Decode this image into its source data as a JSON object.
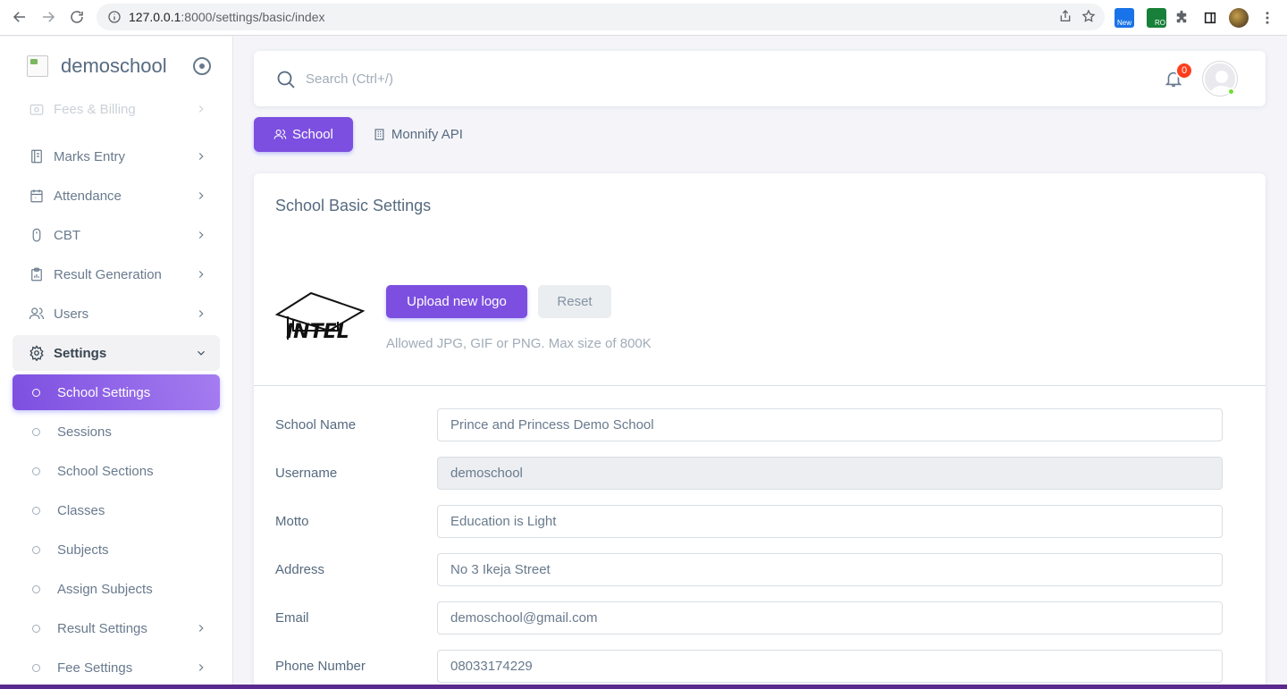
{
  "browser": {
    "url_host": "127.0.0.1",
    "url_path": ":8000/settings/basic/index"
  },
  "sidebar": {
    "brand": "demoschool",
    "items": [
      {
        "label": "Fees & Billing"
      },
      {
        "label": "Marks Entry"
      },
      {
        "label": "Attendance"
      },
      {
        "label": "CBT"
      },
      {
        "label": "Result Generation"
      },
      {
        "label": "Users"
      },
      {
        "label": "Settings"
      }
    ],
    "subitems": [
      {
        "label": "School Settings"
      },
      {
        "label": "Sessions"
      },
      {
        "label": "School Sections"
      },
      {
        "label": "Classes"
      },
      {
        "label": "Subjects"
      },
      {
        "label": "Assign Subjects"
      },
      {
        "label": "Result Settings"
      },
      {
        "label": "Fee Settings"
      }
    ]
  },
  "topbar": {
    "search_placeholder": "Search (Ctrl+/)",
    "notification_count": "0"
  },
  "tabs": [
    {
      "label": "School"
    },
    {
      "label": "Monnify API"
    }
  ],
  "card": {
    "title": "School Basic Settings",
    "logo_text": "INTEL",
    "upload_label": "Upload new logo",
    "reset_label": "Reset",
    "upload_hint": "Allowed JPG, GIF or PNG. Max size of 800K"
  },
  "form": {
    "school_name": {
      "label": "School Name",
      "value": "Prince and Princess Demo School"
    },
    "username": {
      "label": "Username",
      "value": "demoschool"
    },
    "motto": {
      "label": "Motto",
      "value": "Education is Light"
    },
    "address": {
      "label": "Address",
      "value": "No 3 Ikeja Street"
    },
    "email": {
      "label": "Email",
      "value": "demoschool@gmail.com"
    },
    "phone": {
      "label": "Phone Number",
      "value": "08033174229"
    }
  },
  "colors": {
    "accent": "#7d4fe0",
    "badge": "#ff3e1d",
    "online": "#71dd37"
  }
}
